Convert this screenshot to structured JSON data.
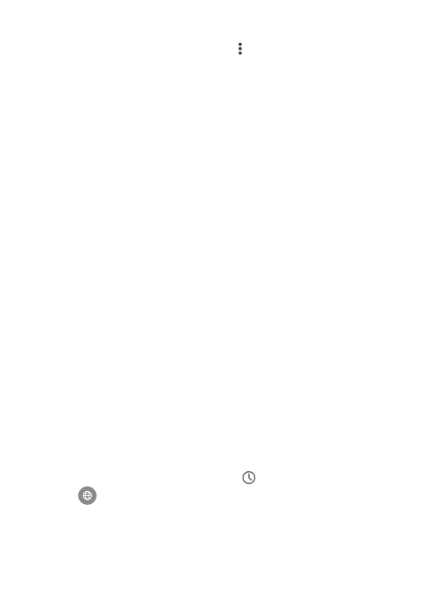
{
  "icons": {
    "overflow": "more-vertical-icon",
    "history": "clock-icon",
    "globe": "globe-icon"
  },
  "colors": {
    "background": "#ffffff",
    "icon_dark": "#444444",
    "icon_mid": "#666666",
    "globe_bg": "#8a8a8a",
    "globe_fg": "#ffffff"
  }
}
